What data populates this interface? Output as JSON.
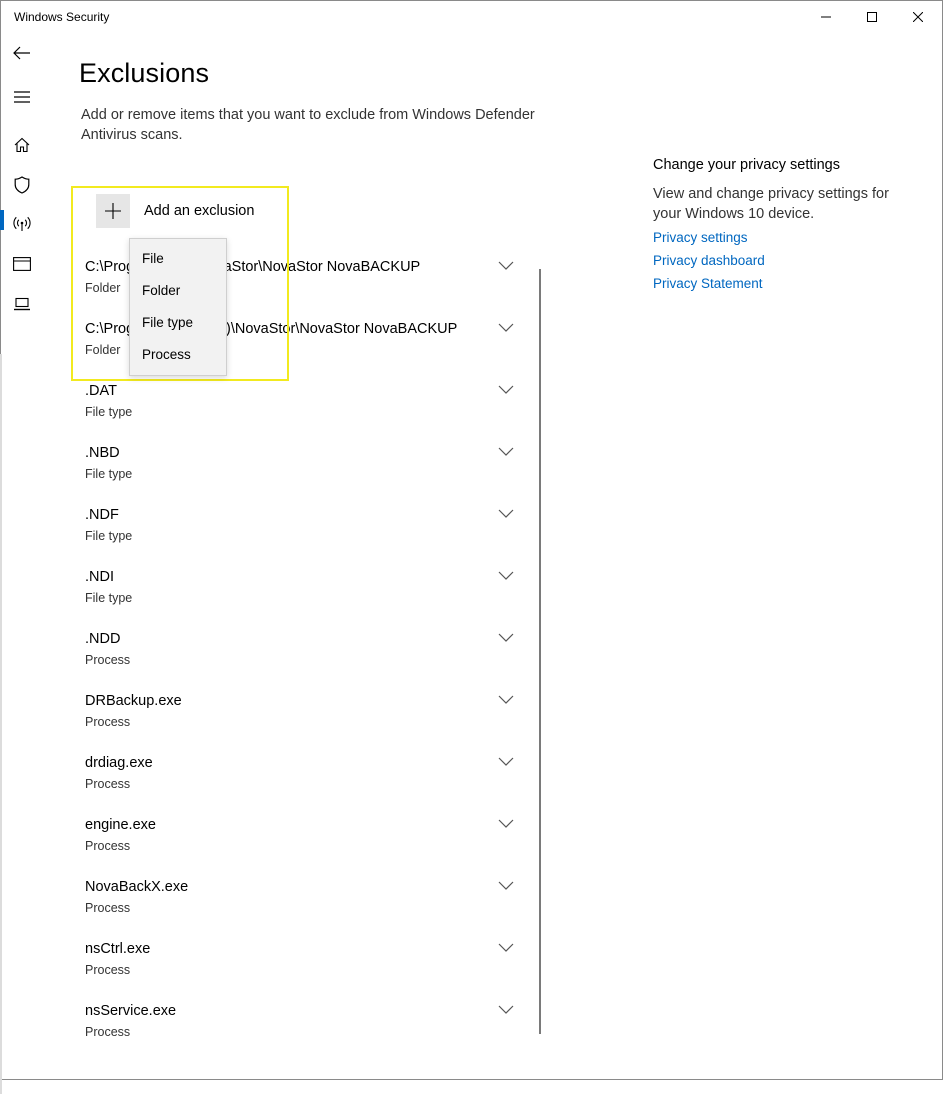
{
  "window": {
    "title": "Windows Security",
    "controls": [
      "minimize",
      "maximize",
      "close"
    ]
  },
  "nav": {
    "icons": [
      "back-arrow-icon",
      "hamburger-menu-icon",
      "home-icon",
      "shield-icon",
      "wireless-icon",
      "app-browser-icon",
      "laptop-icon"
    ],
    "selected": "shield-icon",
    "accent_color": "#0067c0"
  },
  "main": {
    "title": "Exclusions",
    "description": "Add or remove items that you want to exclude from Windows Defender Antivirus scans.",
    "add_button_label": "Add an exclusion",
    "highlight_color": "#f2ea1f",
    "exclusions": [
      {
        "name": "C:\\Program Files\\NovaStor\\NovaStor NovaBACKUP",
        "type": "Folder"
      },
      {
        "name": "C:\\Program Files (x86)\\NovaStor\\NovaStor NovaBACKUP",
        "type": "Folder"
      },
      {
        "name": ".DAT",
        "type": "File type"
      },
      {
        "name": ".NBD",
        "type": "File type"
      },
      {
        "name": ".NDF",
        "type": "File type"
      },
      {
        "name": ".NDI",
        "type": "File type"
      },
      {
        "name": ".NDD",
        "type": "Process"
      },
      {
        "name": "DRBackup.exe",
        "type": "Process"
      },
      {
        "name": "drdiag.exe",
        "type": "Process"
      },
      {
        "name": "engine.exe",
        "type": "Process"
      },
      {
        "name": "NovaBackX.exe",
        "type": "Process"
      },
      {
        "name": "nsCtrl.exe",
        "type": "Process"
      },
      {
        "name": "nsService.exe",
        "type": "Process"
      }
    ],
    "dropdown": {
      "items": [
        "File",
        "Folder",
        "File type",
        "Process"
      ]
    }
  },
  "side_panel": {
    "heading": "Change your privacy settings",
    "text": "View and change privacy settings for your Windows 10 device.",
    "links": [
      "Privacy settings",
      "Privacy dashboard",
      "Privacy Statement"
    ],
    "link_color": "#0067c0"
  }
}
